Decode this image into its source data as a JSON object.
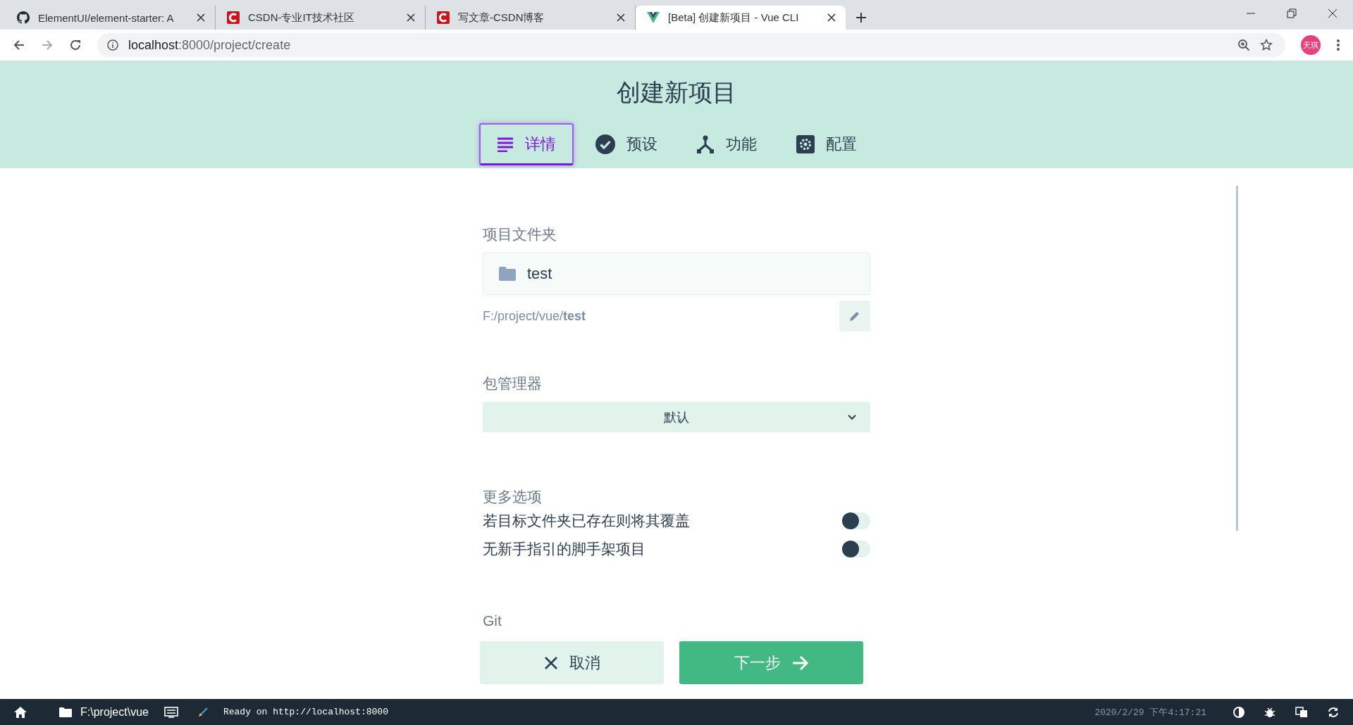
{
  "browser": {
    "tabs": [
      {
        "title": "ElementUI/element-starter: A",
        "selected": false
      },
      {
        "title": "CSDN-专业IT技术社区",
        "selected": false
      },
      {
        "title": "写文章-CSDN博客",
        "selected": false
      },
      {
        "title": "[Beta] 创建新项目 - Vue CLI",
        "selected": true
      }
    ],
    "url_host": "localhost",
    "url_rest": ":8000/project/create",
    "profile": "天琪"
  },
  "page": {
    "title": "创建新项目",
    "steps": [
      {
        "label": "详情",
        "selected": true
      },
      {
        "label": "预设",
        "selected": false
      },
      {
        "label": "功能",
        "selected": false
      },
      {
        "label": "配置",
        "selected": false
      }
    ],
    "folder_label": "项目文件夹",
    "folder_value": "test",
    "path": "F:/project/vue/**test**",
    "package_manager_label": "包管理器",
    "package_manager_value": "默认",
    "more_options_label": "更多选项",
    "options": [
      {
        "label": "若目标文件夹已存在则将其覆盖",
        "on": false
      },
      {
        "label": "无新手指引的脚手架项目",
        "on": false
      }
    ],
    "git_label": "Git",
    "cancel_button": "取消",
    "next_button": "下一步"
  },
  "status_bar": {
    "folder": "F:\\project\\vue",
    "log": "Ready on http://localhost:8000",
    "datetime": "2020/2/29 下午4:17:21"
  }
}
